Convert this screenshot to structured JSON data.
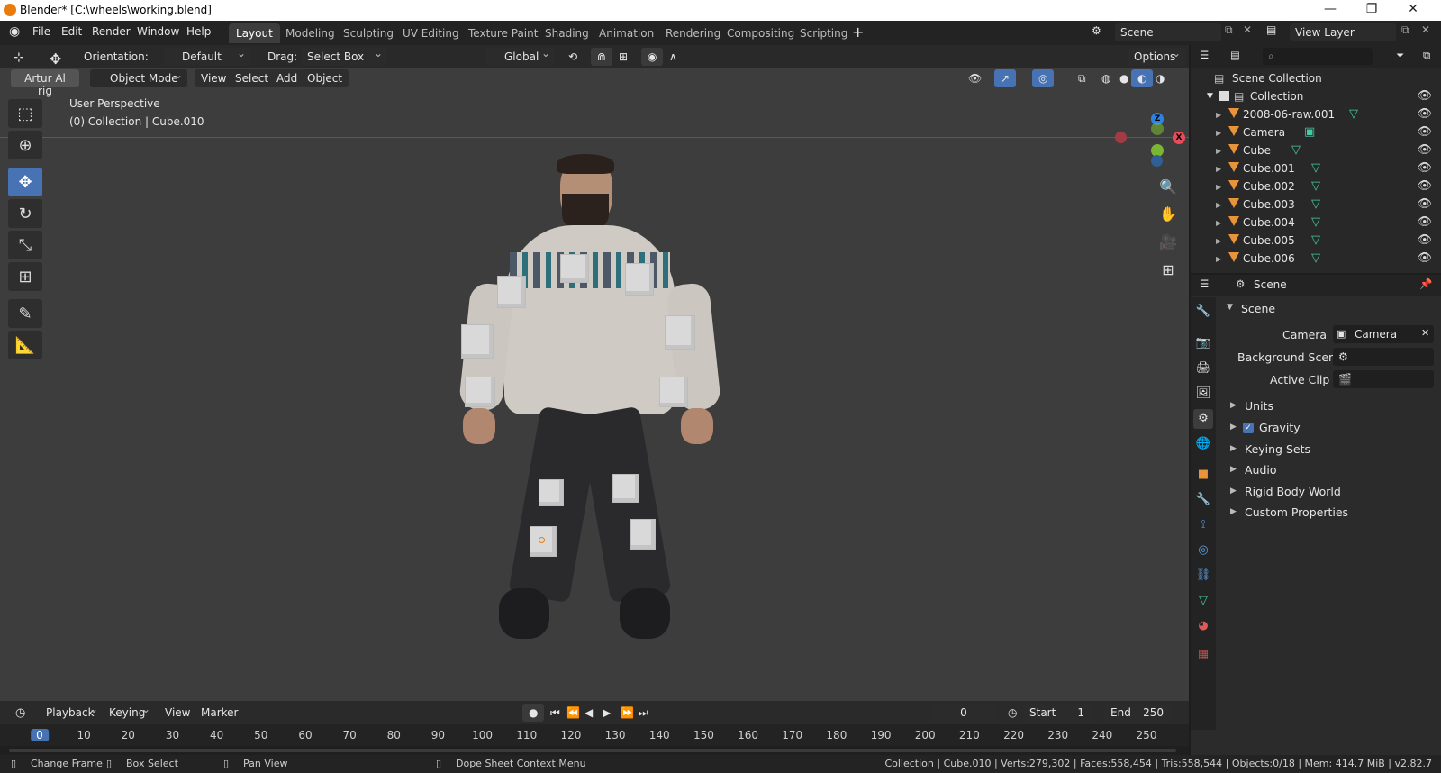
{
  "window": {
    "title": "Blender* [C:\\wheels\\working.blend]",
    "controls": [
      "—",
      "❐",
      "✕"
    ]
  },
  "menu": [
    "File",
    "Edit",
    "Render",
    "Window",
    "Help"
  ],
  "workspaces": [
    "Layout",
    "Modeling",
    "Sculpting",
    "UV Editing",
    "Texture Paint",
    "Shading",
    "Animation",
    "Rendering",
    "Compositing",
    "Scripting"
  ],
  "active_workspace": "Layout",
  "scene_field": "Scene",
  "view_layer_field": "View Layer",
  "viewport_header": {
    "orientation_label": "Orientation:",
    "orientation_value": "Default",
    "drag_label": "Drag:",
    "drag_value": "Select Box",
    "transform_space": "Global",
    "options": "Options"
  },
  "viewport_row2": {
    "rig_button": "Artur Al rig",
    "mode": "Object Mode",
    "menus": [
      "View",
      "Select",
      "Add",
      "Object"
    ]
  },
  "viewport_overlay": {
    "perspective": "User Perspective",
    "context": "(0) Collection | Cube.010"
  },
  "gizmo": {
    "z": "Z",
    "x": "X"
  },
  "timeline": {
    "menus": [
      "Playback",
      "Keying",
      "View",
      "Marker"
    ],
    "current_frame": "0",
    "start_label": "Start",
    "start_value": "1",
    "end_label": "End",
    "end_value": "250",
    "ticks": [
      "0",
      "10",
      "20",
      "30",
      "40",
      "50",
      "60",
      "70",
      "80",
      "90",
      "100",
      "110",
      "120",
      "130",
      "140",
      "150",
      "160",
      "170",
      "180",
      "190",
      "200",
      "210",
      "220",
      "230",
      "240",
      "250"
    ]
  },
  "statusbar": {
    "hints": [
      "Change Frame",
      "Box Select",
      "Pan View",
      "Dope Sheet Context Menu"
    ],
    "stats": "Collection | Cube.010 | Verts:279,302 | Faces:558,454 | Tris:558,544 | Objects:0/18 | Mem: 414.7 MiB | v2.82.7"
  },
  "outliner": {
    "root": "Scene Collection",
    "collection": "Collection",
    "items": [
      "2008-06-raw.001",
      "Camera",
      "Cube",
      "Cube.001",
      "Cube.002",
      "Cube.003",
      "Cube.004",
      "Cube.005",
      "Cube.006"
    ]
  },
  "properties": {
    "header": "Scene",
    "panel": "Scene",
    "camera_label": "Camera",
    "camera_value": "Camera",
    "background_scene_label": "Background Scene",
    "active_clip_label": "Active Clip",
    "subpanels": [
      "Units",
      "Gravity",
      "Keying Sets",
      "Audio",
      "Rigid Body World",
      "Custom Properties"
    ]
  },
  "colors": {
    "accent": "#4772b3",
    "viewport_bg": "#3d3d3d",
    "x_axis": "#e84c5a",
    "y_axis": "#7ab632",
    "z_axis": "#2f83e0"
  }
}
